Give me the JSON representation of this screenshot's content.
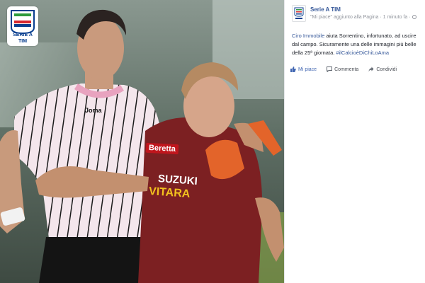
{
  "photo": {
    "logo": {
      "line1": "SERIE A",
      "line2": "TIM"
    },
    "sponsor_left_shirt": "Joma",
    "sponsor_right_1": "Beretta",
    "sponsor_right_2": "SUZUKI",
    "sponsor_right_3": "VITARA"
  },
  "post": {
    "page_name": "Serie A TIM",
    "meta_text": "\"Mi piace\" aggiunto alla Pagina · 1 minuto fa ·",
    "text_link_start": "Ciro Immobile",
    "text_body": " aiuta Sorrentino, infortunato, ad uscire dal campo. Sicuramente una delle immagini più belle della 25ª giornata. ",
    "hashtag": "#ilCalcioèDiChiLoAma",
    "actions": {
      "like": "Mi piace",
      "comment": "Commenta",
      "share": "Condividi"
    }
  },
  "colors": {
    "facebook_link": "#365899",
    "like_blue": "#4267b2",
    "shirt_pink": "#f2dbe4",
    "shirt_maroon": "#7c2022"
  }
}
